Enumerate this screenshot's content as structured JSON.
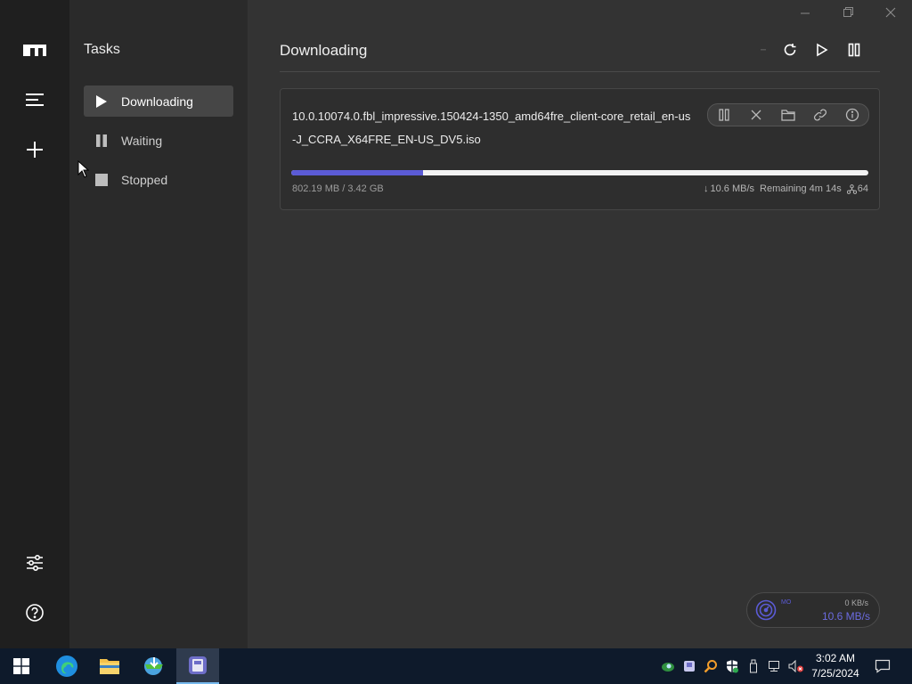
{
  "app": {
    "icons": {
      "logo": "motrix-logo-icon",
      "menu": "hamburger-menu-icon",
      "add": "plus-icon",
      "preferences": "sliders-icon",
      "help": "help-circle-icon"
    }
  },
  "sidebar": {
    "title": "Tasks",
    "items": [
      {
        "label": "Downloading",
        "icon": "play-icon",
        "active": true
      },
      {
        "label": "Waiting",
        "icon": "pause-icon",
        "active": false
      },
      {
        "label": "Stopped",
        "icon": "stop-icon",
        "active": false
      }
    ]
  },
  "window": {
    "controls": [
      "minimize-icon",
      "maximize-icon",
      "close-icon"
    ]
  },
  "main": {
    "title": "Downloading",
    "actions": [
      "refresh-icon",
      "resume-all-icon",
      "pause-all-icon"
    ],
    "task": {
      "filename": "10.0.10074.0.fbl_impressive.150424-1350_amd64fre_client-core_retail_en-us-J_CCRA_X64FRE_EN-US_DV5.iso",
      "progress_fraction": 0.229,
      "size_text": "802.19 MB / 3.42 GB",
      "speed": "10.6 MB/s",
      "speed_arrow": "↓",
      "remaining": "Remaining 4m 14s",
      "connections": "64",
      "actions": [
        "pause-icon",
        "delete-icon",
        "folder-icon",
        "link-icon",
        "info-icon"
      ]
    }
  },
  "speed_widget": {
    "label": "MO",
    "upload": "0 KB/s",
    "download": "10.6 MB/s"
  },
  "taskbar": {
    "apps": [
      "windows-start-icon",
      "edge-icon",
      "file-explorer-icon",
      "idm-icon",
      "motrix-icon"
    ],
    "tray": [
      "network-eye-icon",
      "app-tray-icon",
      "search-tray-icon",
      "defender-icon",
      "usb-icon",
      "network-icon",
      "volume-muted-icon"
    ],
    "time": "3:02 AM",
    "date": "7/25/2024"
  },
  "colors": {
    "accent": "#5b5bd6",
    "iconbar_bg": "#1f1f1f",
    "sidebar_bg": "#2a2a2a",
    "main_bg": "#333333",
    "taskbar_bg": "#0e1a2b"
  }
}
